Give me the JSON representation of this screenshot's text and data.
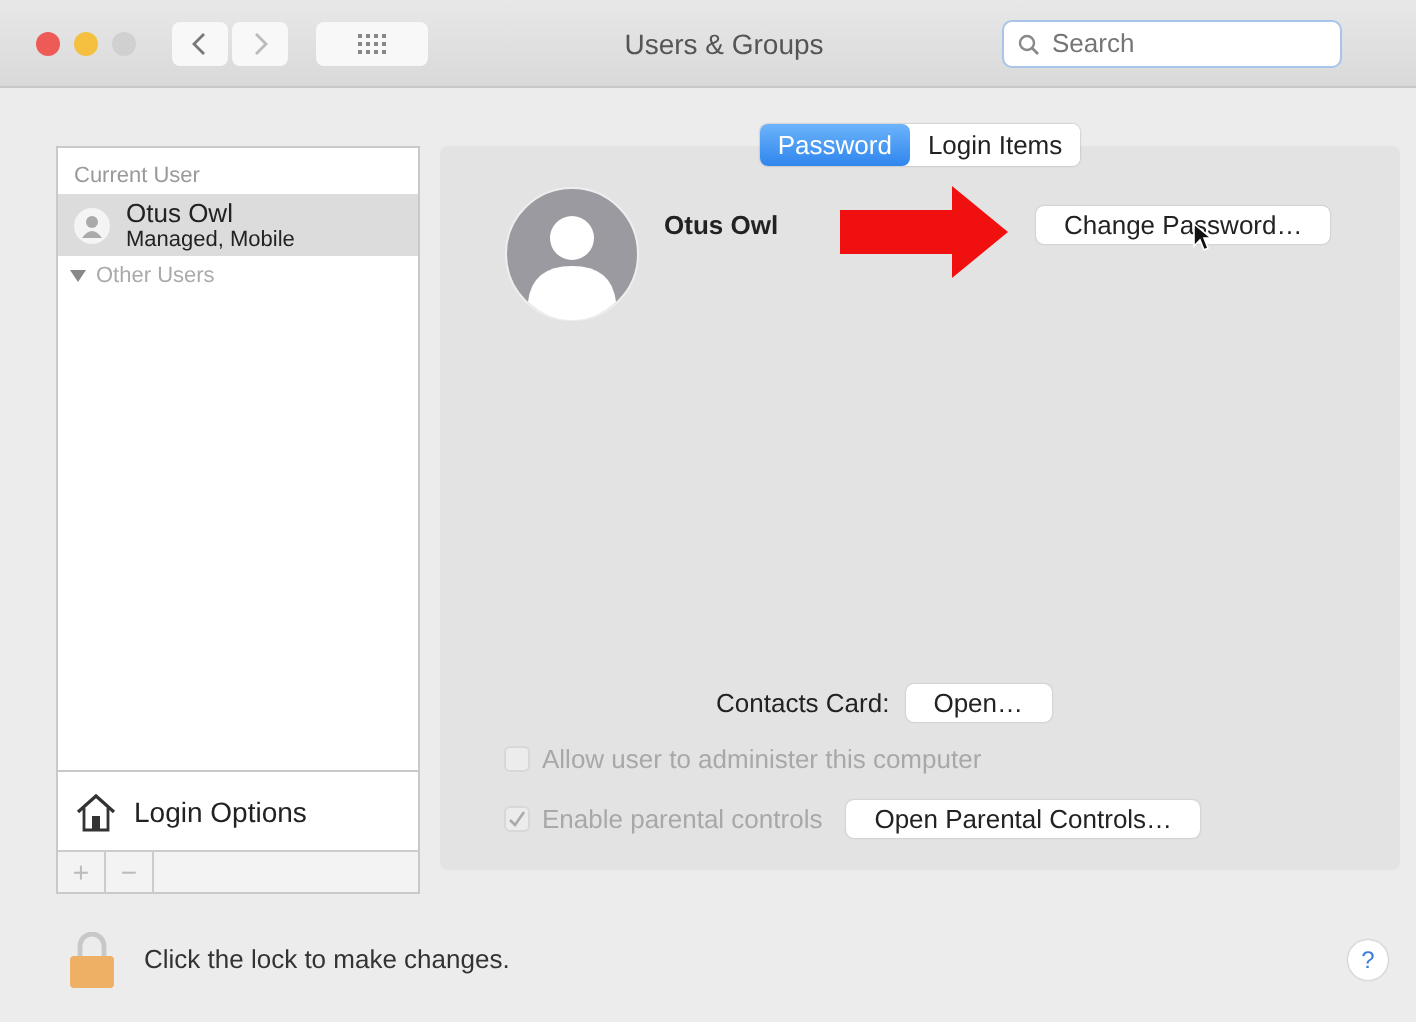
{
  "window": {
    "title": "Users & Groups"
  },
  "search": {
    "placeholder": "Search"
  },
  "sidebar": {
    "current_user_header": "Current User",
    "users": [
      {
        "name": "Otus Owl",
        "subtitle": "Managed, Mobile",
        "selected": true
      }
    ],
    "other_users": {
      "label": "Other Users",
      "expanded": true
    },
    "login_options": "Login Options",
    "buttons": [
      "+",
      "−"
    ]
  },
  "tabs": [
    {
      "label": "Password",
      "selected": true
    },
    {
      "label": "Login Items",
      "selected": false
    }
  ],
  "user": {
    "name": "Otus Owl",
    "change_password": "Change Password…"
  },
  "contacts_card": {
    "label": "Contacts Card:",
    "button": "Open…"
  },
  "options": [
    {
      "label": "Allow user to administer this computer",
      "checked": false,
      "disabled": true
    },
    {
      "label": "Enable parental controls",
      "checked": true,
      "disabled": true
    }
  ],
  "parental_button": "Open Parental Controls…",
  "lock": {
    "text": "Click the lock to make changes."
  },
  "help": "?"
}
